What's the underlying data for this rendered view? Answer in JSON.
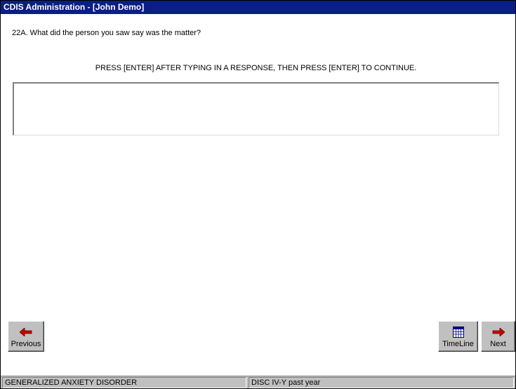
{
  "window": {
    "title": "CDIS Administration - [John Demo]"
  },
  "question": {
    "text": "22A. What did the person you saw say was the matter?"
  },
  "instruction": {
    "text": "PRESS [ENTER] AFTER TYPING IN A RESPONSE, THEN PRESS [ENTER] TO CONTINUE."
  },
  "response": {
    "value": "",
    "placeholder": ""
  },
  "buttons": {
    "previous_label": "Previous",
    "timeline_label": "TimeLine",
    "next_label": "Next"
  },
  "icons": {
    "previous": "arrow-left-icon",
    "timeline": "calendar-grid-icon",
    "next": "arrow-right-icon"
  },
  "status": {
    "section": "GENERALIZED ANXIETY DISORDER",
    "instrument": "DISC IV-Y past year"
  },
  "colors": {
    "titlebar": "#0a1e83",
    "button_face": "#c0c0c0",
    "arrow_red": "#cc0000"
  }
}
